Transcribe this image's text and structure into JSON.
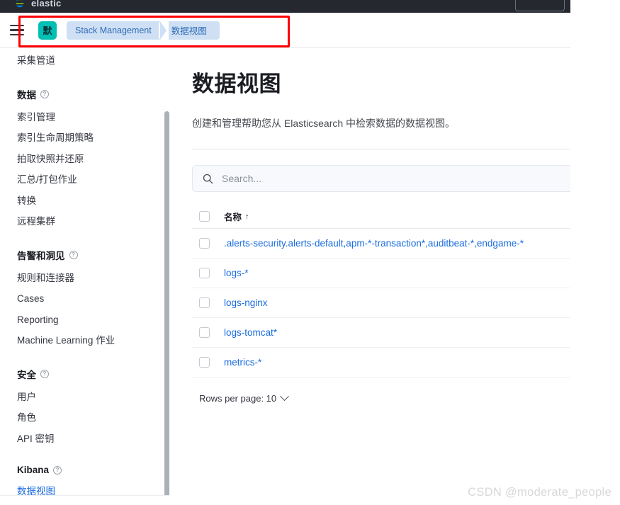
{
  "topbar": {
    "logo_icon": "elastic-logo-icon",
    "brand": "elastic",
    "right_control": "deployment-menu-button"
  },
  "header": {
    "menu_icon": "hamburger-menu-icon",
    "space_avatar": "默",
    "breadcrumbs": [
      {
        "label": "Stack Management"
      },
      {
        "label": "数据视图"
      }
    ]
  },
  "annotation": {
    "color": "#ff0000",
    "note": "red-highlight-box"
  },
  "sidebar": {
    "top_item": {
      "label": "采集管道"
    },
    "groups": [
      {
        "title": "数据",
        "help_icon": "help-circle-icon",
        "items": [
          {
            "label": "索引管理"
          },
          {
            "label": "索引生命周期策略"
          },
          {
            "label": "拍取快照并还原"
          },
          {
            "label": "汇总/打包作业"
          },
          {
            "label": "转换"
          },
          {
            "label": "远程集群"
          }
        ]
      },
      {
        "title": "告警和洞见",
        "help_icon": "help-circle-icon",
        "items": [
          {
            "label": "规则和连接器"
          },
          {
            "label": "Cases"
          },
          {
            "label": "Reporting"
          },
          {
            "label": "Machine Learning 作业"
          }
        ]
      },
      {
        "title": "安全",
        "help_icon": "help-circle-icon",
        "items": [
          {
            "label": "用户"
          },
          {
            "label": "角色"
          },
          {
            "label": "API 密钥"
          }
        ]
      },
      {
        "title": "Kibana",
        "help_icon": "help-circle-icon",
        "items": [
          {
            "label": "数据视图",
            "selected": true
          }
        ]
      }
    ]
  },
  "main": {
    "title": "数据视图",
    "description": "创建和管理帮助您从 Elasticsearch 中检索数据的数据视图。",
    "search": {
      "icon": "search-icon",
      "placeholder": "Search...",
      "value": ""
    },
    "table": {
      "columns": [
        {
          "key": "select",
          "label": ""
        },
        {
          "key": "name",
          "label": "名称",
          "sort": "↑"
        }
      ],
      "rows": [
        {
          "name": ".alerts-security.alerts-default,apm-*-transaction*,auditbeat-*,endgame-*",
          "checked": false
        },
        {
          "name": "logs-*",
          "checked": false
        },
        {
          "name": "logs-nginx",
          "checked": false
        },
        {
          "name": "logs-tomcat*",
          "checked": false
        },
        {
          "name": "metrics-*",
          "checked": false
        }
      ]
    },
    "pagination": {
      "label": "Rows per page: 10",
      "chevron_icon": "chevron-down-icon"
    }
  },
  "watermark": {
    "text": "CSDN @moderate_people"
  },
  "colors": {
    "accent_link": "#1a6ce0",
    "space_avatar_bg": "#00bfb3",
    "breadcrumb_bg": "#cfe0f5",
    "topbar_bg": "#25282f",
    "annotation": "#ff0000"
  }
}
